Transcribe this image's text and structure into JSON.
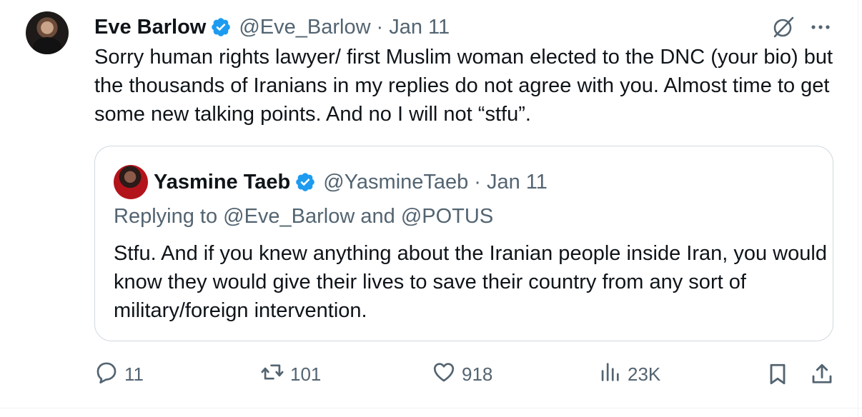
{
  "tweet": {
    "author": {
      "name": "Eve Barlow",
      "handle": "@Eve_Barlow",
      "separator": "·",
      "date": "Jan 11",
      "verified": true
    },
    "text": "Sorry human rights lawyer/ first Muslim woman elected to the DNC (your bio) but the thousands of Iranians in my replies do not agree with you. Almost time to get some new talking points. And no I will not “stfu”."
  },
  "quoted_tweet": {
    "author": {
      "name": "Yasmine Taeb",
      "handle": "@YasmineTaeb",
      "separator": "·",
      "date": "Jan 11",
      "verified": true
    },
    "replying_to": "Replying to @Eve_Barlow and @POTUS",
    "text": "Stfu. And if you knew anything about the Iranian people inside Iran, you would know they would give their lives to save their country from any sort of military/foreign intervention."
  },
  "actions": {
    "replies": "11",
    "reposts": "101",
    "likes": "918",
    "views": "23K"
  },
  "icons": {
    "verified": "verified-badge-icon",
    "grok": "grok-icon",
    "more": "more-icon",
    "reply": "reply-icon",
    "repost": "repost-icon",
    "like": "like-icon",
    "views": "views-icon",
    "bookmark": "bookmark-icon",
    "share": "share-icon"
  },
  "colors": {
    "verified_blue": "#1d9bf0",
    "text_primary": "#0f1419",
    "text_secondary": "#536471",
    "border": "#cfd9de"
  }
}
